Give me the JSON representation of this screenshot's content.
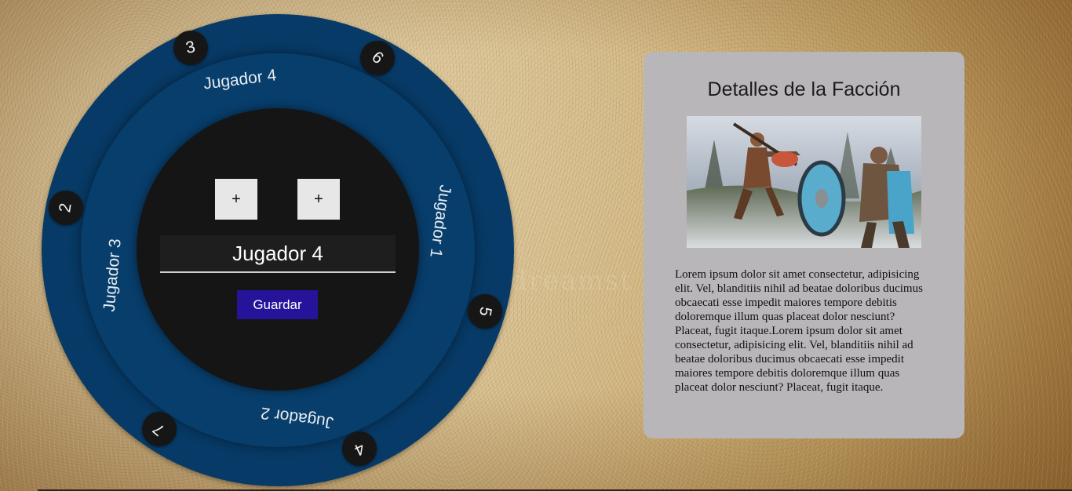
{
  "wheel": {
    "players": [
      {
        "name": "Jugador 4",
        "position": "top"
      },
      {
        "name": "Jugador 1",
        "position": "right"
      },
      {
        "name": "Jugador 2",
        "position": "bottom"
      },
      {
        "name": "Jugador 3",
        "position": "left"
      }
    ],
    "seats": [
      "3",
      "6",
      "2",
      "5",
      "7",
      "4"
    ],
    "colors": {
      "outer_ring": "#073a66",
      "inner_disc": "#151515",
      "seat_badge": "#161616"
    }
  },
  "editor": {
    "add_left_label": "+",
    "add_right_label": "+",
    "name_value": "Jugador 4",
    "save_label": "Guardar",
    "save_color": "#25139a"
  },
  "details": {
    "title": "Detalles de la Facción",
    "image_alt": "faction-artwork",
    "description": "Lorem ipsum dolor sit amet consectetur, adipisicing elit. Vel, blanditiis nihil ad beatae doloribus ducimus obcaecati esse impedit maiores tempore debitis doloremque illum quas placeat dolor nesciunt? Placeat, fugit itaque.Lorem ipsum dolor sit amet consectetur, adipisicing elit. Vel, blanditiis nihil ad beatae doloribus ducimus obcaecati esse impedit maiores tempore debitis doloremque illum quas placeat dolor nesciunt? Placeat, fugit itaque.",
    "card_color": "#b9b6ba"
  }
}
